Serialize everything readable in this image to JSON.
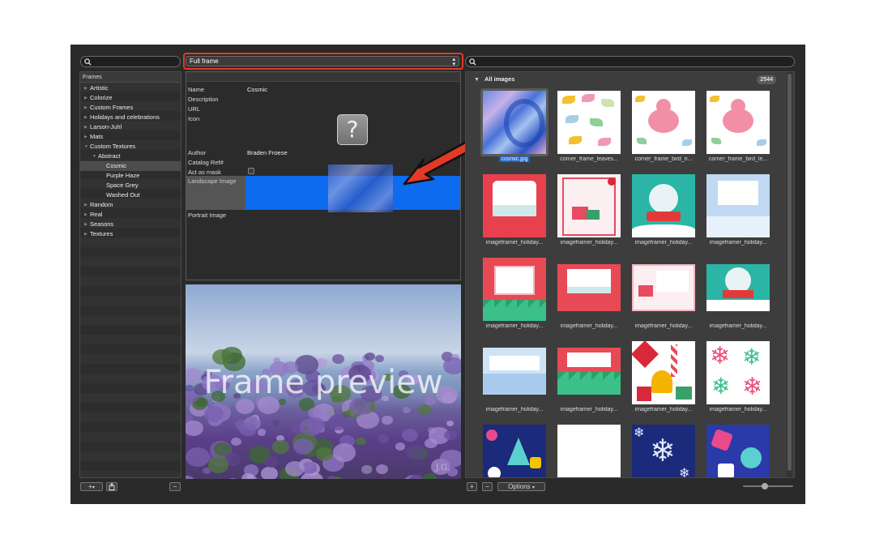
{
  "frame_select": {
    "value": "Full frame"
  },
  "frames_panel": {
    "header": "Frames",
    "items": [
      {
        "label": "Artistic",
        "level": 0
      },
      {
        "label": "Colorize",
        "level": 0
      },
      {
        "label": "Custom Frames",
        "level": 0
      },
      {
        "label": "Holidays and celebrations",
        "level": 0
      },
      {
        "label": "Larson-Juhl",
        "level": 0
      },
      {
        "label": "Mats",
        "level": 0
      },
      {
        "label": "Custom Textures",
        "level": 0,
        "expanded": true
      },
      {
        "label": "Abstract",
        "level": 1,
        "expanded": true
      },
      {
        "label": "Cosmic",
        "level": 2,
        "selected": true
      },
      {
        "label": "Purple Haze",
        "level": 2
      },
      {
        "label": "Space Grey",
        "level": 2
      },
      {
        "label": "Washed Out",
        "level": 2
      },
      {
        "label": "Random",
        "level": 0
      },
      {
        "label": "Real",
        "level": 0
      },
      {
        "label": "Seasons",
        "level": 0
      },
      {
        "label": "Textures",
        "level": 0
      }
    ]
  },
  "properties": {
    "name_label": "Name",
    "name_value": "Cosmic",
    "description_label": "Description",
    "url_label": "URL",
    "icon_label": "Icon",
    "icon_placeholder": "?",
    "author_label": "Author",
    "author_value": "Braden Froese",
    "catalog_label": "Catalog Ref#",
    "mask_label": "Act as mask",
    "landscape_label": "Landscape Image",
    "portrait_label": "Portrait Image"
  },
  "preview": {
    "overlay_text": "Frame preview",
    "signature": "J.G."
  },
  "gallery": {
    "header": "All images",
    "count": "2544",
    "tiles": [
      {
        "caption": "cosmic.jpg",
        "kind": "cosmic",
        "selected": true
      },
      {
        "caption": "corner_frame_leaves...",
        "kind": "leaves"
      },
      {
        "caption": "corner_frame_bird_ri...",
        "kind": "bird"
      },
      {
        "caption": "corner_frame_bird_le...",
        "kind": "bird"
      },
      {
        "caption": "imageframer_holiday...",
        "kind": "red-card"
      },
      {
        "caption": "imageframer_holiday...",
        "kind": "happy-holidays"
      },
      {
        "caption": "imageframer_holiday...",
        "kind": "snowglobe-tall"
      },
      {
        "caption": "imageframer_holiday...",
        "kind": "blue-card"
      },
      {
        "caption": "imageframer_holiday...",
        "kind": "trees-card"
      },
      {
        "caption": "imageframer_holiday...",
        "kind": "red-wide"
      },
      {
        "caption": "imageframer_holiday...",
        "kind": "holidays-wide"
      },
      {
        "caption": "imageframer_holiday...",
        "kind": "snowglobe-wide"
      },
      {
        "caption": "imageframer_holiday...",
        "kind": "blue-wide"
      },
      {
        "caption": "imageframer_holiday...",
        "kind": "trees-wide"
      },
      {
        "caption": "imageframer_holiday...",
        "kind": "bells"
      },
      {
        "caption": "imageframer_holiday...",
        "kind": "snowflakes-pink"
      },
      {
        "caption": "",
        "kind": "navy-pattern"
      },
      {
        "caption": "",
        "kind": "white"
      },
      {
        "caption": "",
        "kind": "navy-snow"
      },
      {
        "caption": "",
        "kind": "navy-pattern2"
      }
    ]
  },
  "bottom_bar": {
    "add_label": "+",
    "menu_arrow": "▾",
    "remove_label": "−",
    "options_label": "Options",
    "options_arrow": "▾"
  }
}
